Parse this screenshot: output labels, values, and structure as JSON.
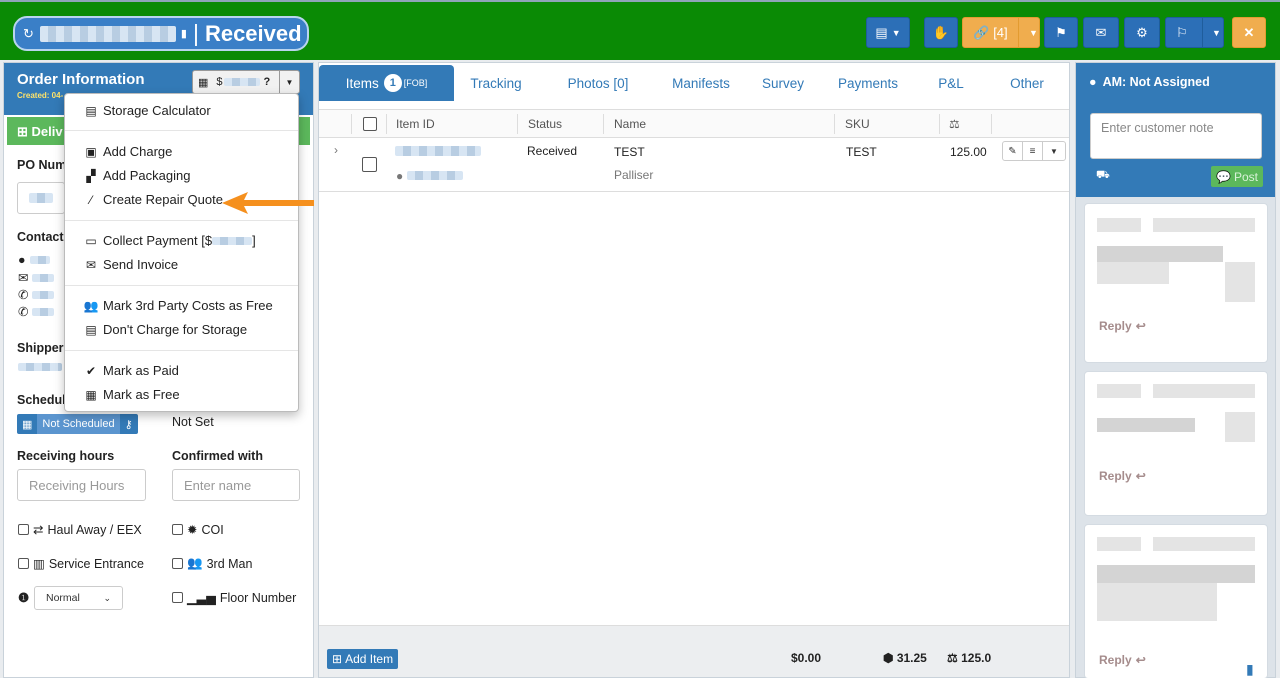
{
  "header": {
    "status_title": "Received",
    "sep": "|",
    "links_label": "[4]",
    "close_glyph": "✕"
  },
  "order_info": {
    "title": "Order Information",
    "created_label": "Created: 04-",
    "money_prefix": "$",
    "delivery_label": "Deliv",
    "po_label": "PO Num",
    "contact_label": "Contact",
    "shipper_label": "Shipper",
    "schedule_label": "Schedul",
    "schedule_pill": "Not Scheduled",
    "not_set": "Not Set",
    "receiving_hours_label": "Receiving hours",
    "receiving_hours_placeholder": "Receiving Hours",
    "confirmed_with_label": "Confirmed with",
    "confirmed_with_placeholder": "Enter name",
    "options": {
      "haul_away": "Haul Away / EEX",
      "coi": "COI",
      "service_entrance": "Service Entrance",
      "third_man": "3rd Man",
      "floor_number": "Floor Number"
    },
    "priority_value": "Normal"
  },
  "menu": {
    "storage_calculator": "Storage Calculator",
    "add_charge": "Add Charge",
    "add_packaging": "Add Packaging",
    "create_repair_quote": "Create Repair Quote",
    "collect_payment": "Collect Payment [$",
    "collect_payment_end": "]",
    "send_invoice": "Send Invoice",
    "mark_third_party_free": "Mark 3rd Party Costs as Free",
    "dont_charge_storage": "Don't Charge for Storage",
    "mark_paid": "Mark as Paid",
    "mark_free": "Mark as Free"
  },
  "tabs": {
    "items": "Items",
    "items_count": "1",
    "items_sup": "[FOB]",
    "tracking": "Tracking",
    "photos": "Photos [0]",
    "manifests": "Manifests",
    "survey": "Survey",
    "payments": "Payments",
    "pl": "P&L",
    "other": "Other"
  },
  "table": {
    "headers": {
      "item_id": "Item ID",
      "status": "Status",
      "name": "Name",
      "sku": "SKU"
    },
    "rows": [
      {
        "status": "Received",
        "name": "TEST",
        "sub": "Palliser",
        "sku": "TEST",
        "weight": "125.00"
      }
    ]
  },
  "footer": {
    "add_item": "Add Item",
    "total": "$0.00",
    "volume": "31.25",
    "weight": "125.0"
  },
  "sidebar_right": {
    "am_label": "AM: Not Assigned",
    "note_placeholder": "Enter customer note",
    "post_label": "Post",
    "reply_label": "Reply"
  },
  "colors": {
    "topbar_green": "#0a8a05",
    "primary_blue": "#337ab7",
    "success_green": "#5cb85c",
    "warning_orange": "#f0ad4e",
    "arrow_orange": "#f5901e"
  }
}
